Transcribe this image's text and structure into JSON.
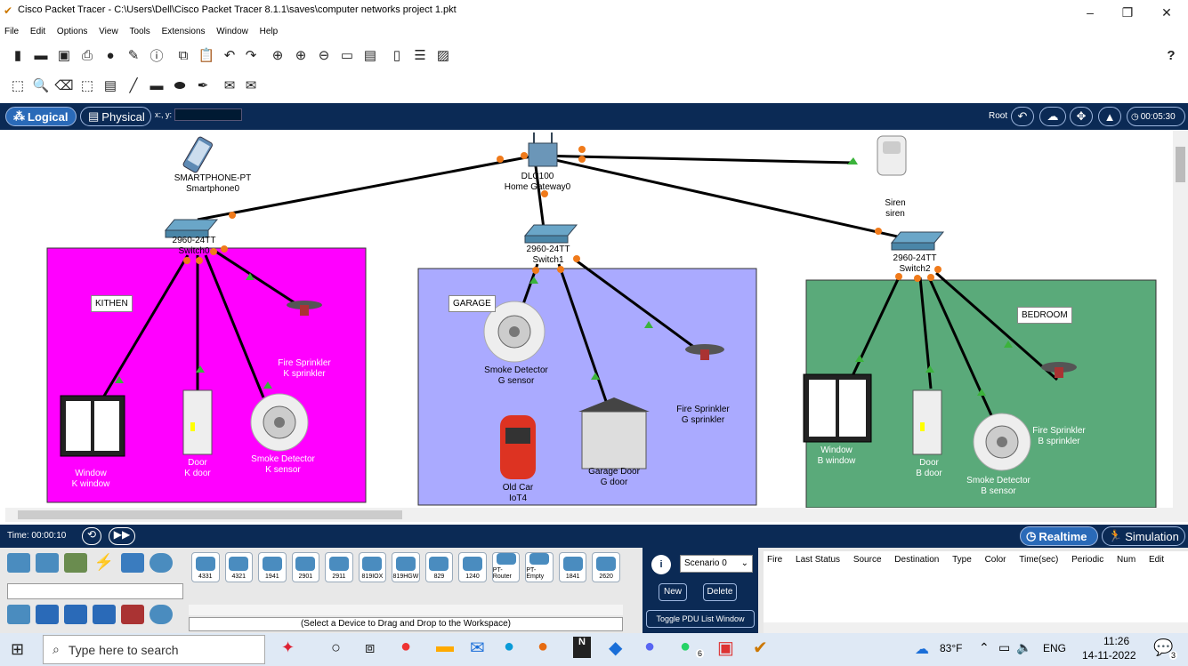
{
  "window": {
    "title": "Cisco Packet Tracer - C:\\Users\\Dell\\Cisco Packet Tracer 8.1.1\\saves\\computer networks project 1.pkt",
    "minimize": "–",
    "restore": "❐",
    "close": "✕"
  },
  "menu": [
    "File",
    "Edit",
    "Options",
    "View",
    "Tools",
    "Extensions",
    "Window",
    "Help"
  ],
  "help_glyph": "?",
  "tabs": {
    "logical": "Logical",
    "physical": "Physical",
    "coords": "x:, y:"
  },
  "workspace_header": {
    "root": "Root",
    "clock": "00:05:30"
  },
  "rooms": [
    {
      "label": "KITHEN",
      "color": "#ff00ff"
    },
    {
      "label": "GARAGE",
      "color": "#aaaaff"
    },
    {
      "label": "BEDROOM",
      "color": "#5aaa7a"
    }
  ],
  "devices": {
    "smartphone": [
      "SMARTPHONE-PT",
      "Smartphone0"
    ],
    "gateway": [
      "DLC100",
      "Home Gateway0"
    ],
    "siren": [
      "Siren",
      "siren"
    ],
    "switch0": [
      "2960-24TT",
      "Switch0"
    ],
    "switch1": [
      "2960-24TT",
      "Switch1"
    ],
    "switch2": [
      "2960-24TT",
      "Switch2"
    ],
    "k_window": [
      "Window",
      "K window"
    ],
    "k_door": [
      "Door",
      "K door"
    ],
    "k_smoke": [
      "Smoke Detector",
      "K sensor"
    ],
    "k_sprinkler": [
      "Fire Sprinkler",
      "K sprinkler"
    ],
    "g_smoke": [
      "Smoke Detector",
      "G sensor"
    ],
    "g_car": [
      "Old Car",
      "IoT4"
    ],
    "g_door": [
      "Garage Door",
      "G door"
    ],
    "g_sprinkler": [
      "Fire Sprinkler",
      "G sprinkler"
    ],
    "b_window": [
      "Window",
      "B window"
    ],
    "b_door": [
      "Door",
      "B door"
    ],
    "b_smoke": [
      "Smoke Detector",
      "B sensor"
    ],
    "b_sprinkler": [
      "Fire Sprinkler",
      "B sprinkler"
    ]
  },
  "timebar": {
    "time": "Time: 00:00:10",
    "realtime": "Realtime",
    "simulation": "Simulation"
  },
  "device_models": [
    "4331",
    "4321",
    "1941",
    "2901",
    "2911",
    "819IOX",
    "819HGW",
    "829",
    "1240",
    "PT-Router",
    "PT-Empty",
    "1841",
    "2620"
  ],
  "device_hint": "(Select a Device to Drag and Drop to the Workspace)",
  "scenario": {
    "selected": "Scenario 0",
    "new": "New",
    "delete": "Delete",
    "toggle": "Toggle PDU List Window"
  },
  "pdu_headers": [
    "Fire",
    "Last Status",
    "Source",
    "Destination",
    "Type",
    "Color",
    "Time(sec)",
    "Periodic",
    "Num",
    "Edit"
  ],
  "taskbar": {
    "search": "Type here to search",
    "weather": "83°F",
    "lang": "ENG",
    "time": "11:26",
    "date": "14-11-2022",
    "badge_whatsapp": "6",
    "badge_notify": "3"
  }
}
